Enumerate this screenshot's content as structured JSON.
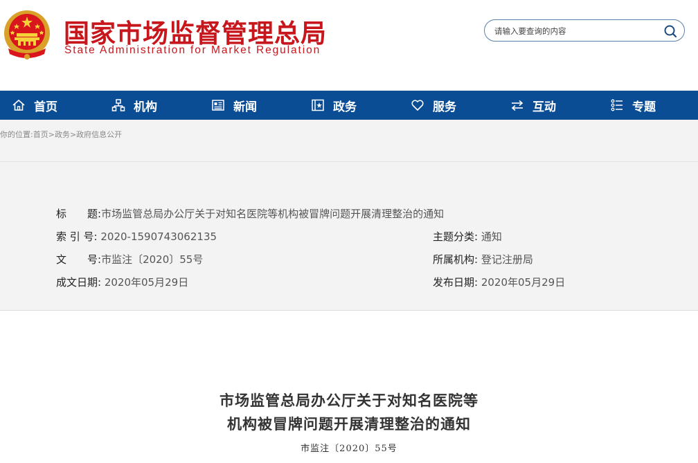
{
  "header": {
    "title": "国家市场监督管理总局",
    "subtitle": "State Administration for Market Regulation",
    "search_placeholder": "请输入要查询的内容"
  },
  "nav": {
    "items": [
      {
        "label": "首页",
        "icon": "home-icon"
      },
      {
        "label": "机构",
        "icon": "org-chart-icon"
      },
      {
        "label": "新闻",
        "icon": "newspaper-icon"
      },
      {
        "label": "政务",
        "icon": "government-book-icon"
      },
      {
        "label": "服务",
        "icon": "heart-icon"
      },
      {
        "label": "互动",
        "icon": "exchange-arrows-icon"
      },
      {
        "label": "专题",
        "icon": "topics-icon"
      }
    ]
  },
  "breadcrumb": {
    "prefix": "你的位置:",
    "items": [
      "首页",
      "政务",
      "政府信息公开"
    ],
    "separator": ">"
  },
  "info": {
    "title_label": "标　　题:",
    "title_value": "市场监管总局办公厅关于对知名医院等机构被冒牌问题开展清理整治的通知",
    "index_label": "索 引 号:",
    "index_value": "2020-1590743062135",
    "category_label": "主题分类:",
    "category_value": "通知",
    "docno_label": "文　　号:",
    "docno_value": "市监注〔2020〕55号",
    "agency_label": "所属机构:",
    "agency_value": "登记注册局",
    "created_label": "成文日期:",
    "created_value": "2020年05月29日",
    "published_label": "发布日期:",
    "published_value": "2020年05月29日"
  },
  "article": {
    "title_line1": "市场监管总局办公厅关于对知名医院等",
    "title_line2": "机构被冒牌问题开展清理整治的通知",
    "doc_number": "市监注〔2020〕55号"
  },
  "colors": {
    "brand_red": "#c8161d",
    "nav_blue": "#0b4d94",
    "panel_gray": "#f3f3f3"
  }
}
